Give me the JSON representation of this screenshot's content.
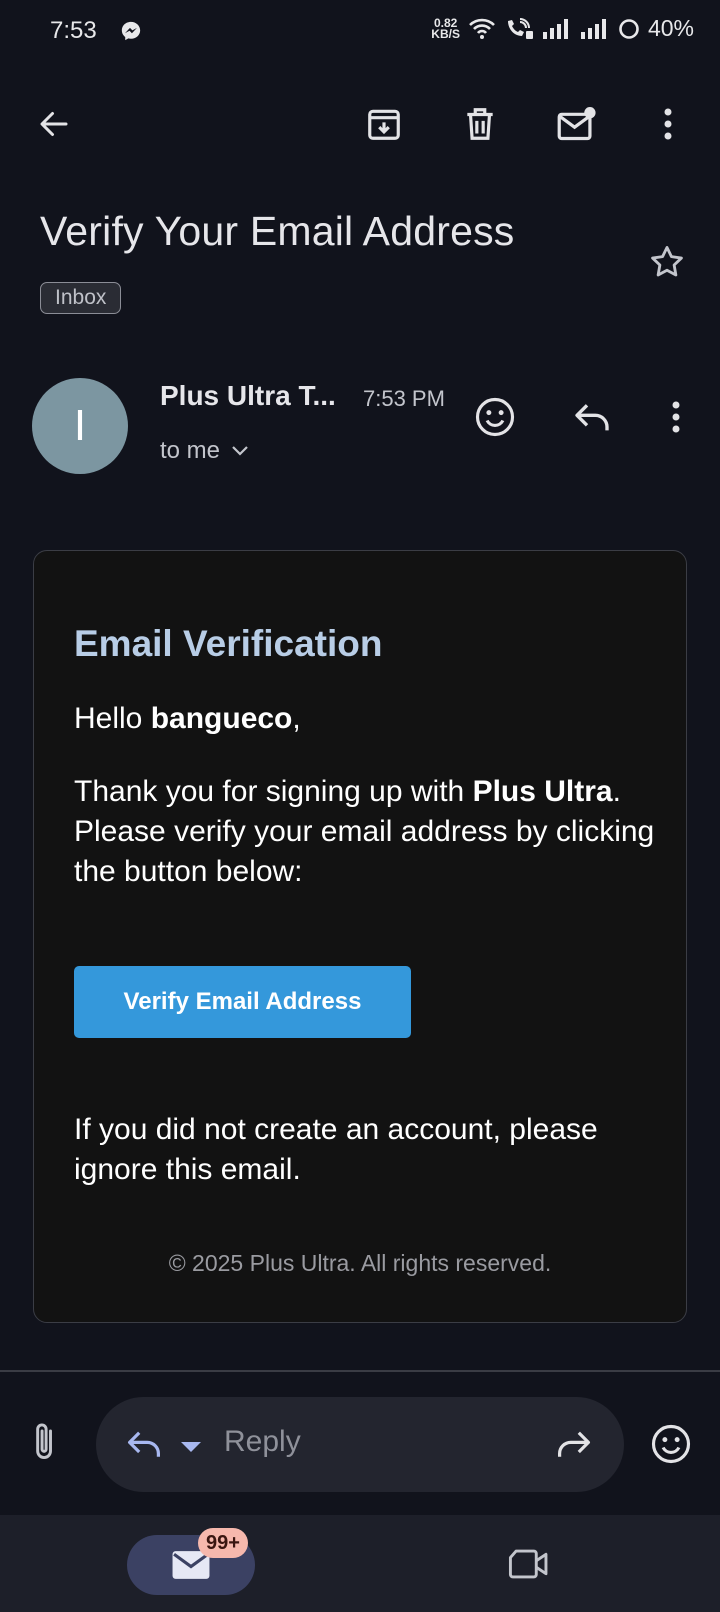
{
  "status_bar": {
    "time": "7:53",
    "net_speed_value": "0.82",
    "net_speed_unit": "KB/S",
    "battery": "40%",
    "icons": [
      "messenger-icon",
      "wifi-icon",
      "wifi-calling-icon",
      "signal-icon",
      "signal-icon",
      "battery-icon"
    ]
  },
  "toolbar": {
    "icons": [
      "back-arrow-icon",
      "archive-icon",
      "delete-icon",
      "mark-unread-icon",
      "more-vert-icon"
    ]
  },
  "subject": "Verify Your Email Address",
  "label": "Inbox",
  "sender": {
    "avatar_letter": "I",
    "name": "Plus Ultra T...",
    "time": "7:53 PM",
    "recipient": "to me"
  },
  "email": {
    "title": "Email Verification",
    "greeting_prefix": "Hello ",
    "username": "bangueco",
    "greeting_suffix": ",",
    "para_prefix": "Thank you for signing up with ",
    "brand": "Plus Ultra",
    "para_suffix": ". Please verify your email address by clicking the button below:",
    "button_label": "Verify Email Address",
    "ignore_text": "If you did not create an account, please ignore this email.",
    "copyright": "© 2025 Plus Ultra. All rights reserved."
  },
  "reply_bar": {
    "placeholder": "Reply"
  },
  "bottom_nav": {
    "mail_badge": "99+"
  },
  "colors": {
    "background": "#11131c",
    "accent_button": "#3498db",
    "title_blue": "#b8cde6",
    "badge": "#f6b8ad"
  }
}
